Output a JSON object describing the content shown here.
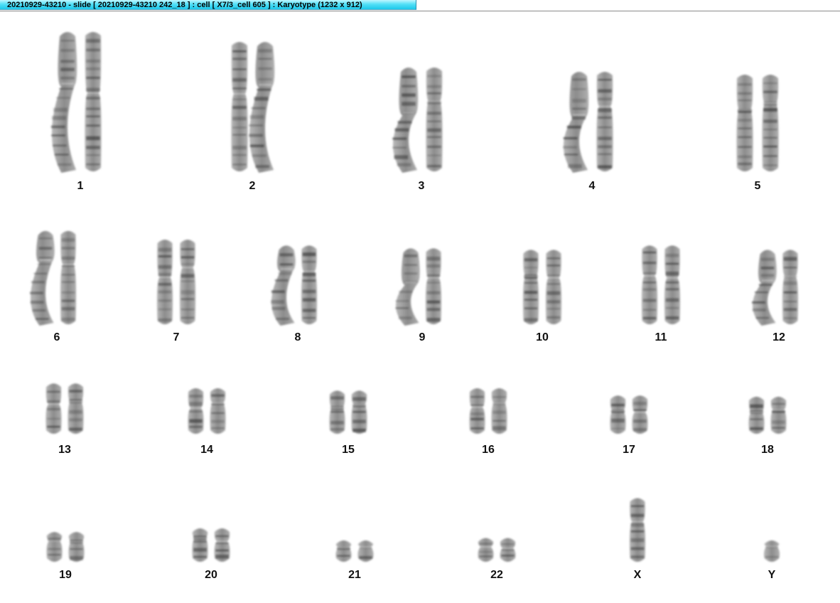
{
  "window": {
    "title": "20210929-43210 - slide [ 20210929-43210 242_18 ] : cell [ X7/3_cell 605 ] : Karyotype  (1232 x 912)"
  },
  "karyotype": {
    "rows": [
      {
        "groups": [
          {
            "label": "1",
            "count": 2,
            "size": 1.0,
            "bent": [
              true,
              false
            ]
          },
          {
            "label": "2",
            "count": 2,
            "size": 0.93,
            "bent": [
              false,
              true
            ]
          },
          {
            "label": "3",
            "count": 2,
            "size": 0.75,
            "bent": [
              true,
              false
            ]
          },
          {
            "label": "4",
            "count": 2,
            "size": 0.72,
            "bent": [
              true,
              false
            ]
          },
          {
            "label": "5",
            "count": 2,
            "size": 0.7,
            "bent": [
              false,
              false
            ]
          }
        ]
      },
      {
        "groups": [
          {
            "label": "6",
            "count": 2,
            "size": 0.66,
            "bent": [
              true,
              false
            ]
          },
          {
            "label": "7",
            "count": 2,
            "size": 0.6,
            "bent": [
              false,
              false
            ]
          },
          {
            "label": "8",
            "count": 2,
            "size": 0.56,
            "bent": [
              true,
              false
            ]
          },
          {
            "label": "9",
            "count": 2,
            "size": 0.54,
            "bent": [
              true,
              false
            ]
          },
          {
            "label": "10",
            "count": 2,
            "size": 0.53,
            "bent": [
              false,
              false
            ]
          },
          {
            "label": "11",
            "count": 2,
            "size": 0.56,
            "bent": [
              false,
              false
            ]
          },
          {
            "label": "12",
            "count": 2,
            "size": 0.53,
            "bent": [
              true,
              false
            ]
          }
        ]
      },
      {
        "groups": [
          {
            "label": "13",
            "count": 2,
            "size": 0.44,
            "bent": [
              false,
              false
            ]
          },
          {
            "label": "14",
            "count": 2,
            "size": 0.4,
            "bent": [
              false,
              false
            ]
          },
          {
            "label": "15",
            "count": 2,
            "size": 0.38,
            "bent": [
              false,
              false
            ]
          },
          {
            "label": "16",
            "count": 2,
            "size": 0.4,
            "bent": [
              false,
              false
            ]
          },
          {
            "label": "17",
            "count": 2,
            "size": 0.34,
            "bent": [
              false,
              false
            ]
          },
          {
            "label": "18",
            "count": 2,
            "size": 0.33,
            "bent": [
              false,
              false
            ]
          }
        ]
      },
      {
        "groups": [
          {
            "label": "19",
            "count": 2,
            "size": 0.27,
            "bent": [
              false,
              false
            ]
          },
          {
            "label": "20",
            "count": 2,
            "size": 0.3,
            "bent": [
              false,
              false
            ]
          },
          {
            "label": "21",
            "count": 2,
            "size": 0.2,
            "bent": [
              false,
              false
            ]
          },
          {
            "label": "22",
            "count": 2,
            "size": 0.22,
            "bent": [
              false,
              false
            ]
          },
          {
            "label": "X",
            "count": 1,
            "size": 0.55,
            "bent": [
              false
            ]
          },
          {
            "label": "Y",
            "count": 1,
            "size": 0.2,
            "bent": [
              false
            ]
          }
        ]
      }
    ]
  },
  "colors": {
    "titlebar_accent": "#1cc7ea",
    "chromosome_base": "#9a9a9a",
    "chromosome_band": "#3c3c3c",
    "label": "#111111",
    "background": "#ffffff"
  }
}
